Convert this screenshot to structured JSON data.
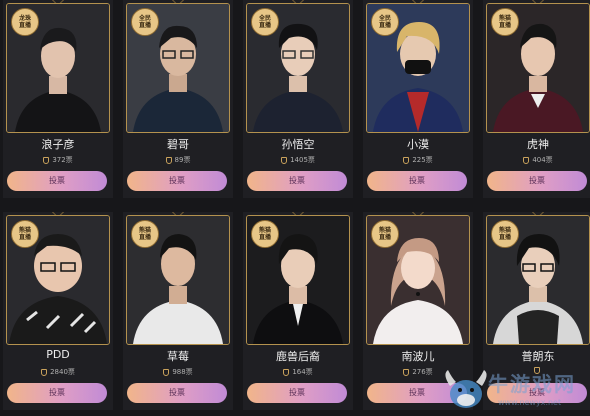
{
  "vote_label": "投票",
  "cards": [
    {
      "name": "浪子彦",
      "votes": "372票",
      "badge": "龙珠直播"
    },
    {
      "name": "碧哥",
      "votes": "89票",
      "badge": "全民直播"
    },
    {
      "name": "孙悟空",
      "votes": "1405票",
      "badge": "全民直播"
    },
    {
      "name": "小漠",
      "votes": "225票",
      "badge": "全民直播"
    },
    {
      "name": "虎神",
      "votes": "404票",
      "badge": "熊猫直播"
    },
    {
      "name": "PDD",
      "votes": "2840票",
      "badge": "熊猫直播"
    },
    {
      "name": "草莓",
      "votes": "988票",
      "badge": "熊猫直播"
    },
    {
      "name": "鹿兽后裔",
      "votes": "164票",
      "badge": "熊猫直播"
    },
    {
      "name": "南波儿",
      "votes": "276票",
      "badge": "熊猫直播"
    },
    {
      "name": "普朗东",
      "votes": "",
      "badge": "熊猫直播"
    }
  ],
  "watermark": {
    "text": "牛游戏网",
    "url": "www.newyx.net"
  },
  "colors": {
    "accent_gold": "#b4924e",
    "button_start": "#f1b58a",
    "button_end": "#c18bd6"
  }
}
